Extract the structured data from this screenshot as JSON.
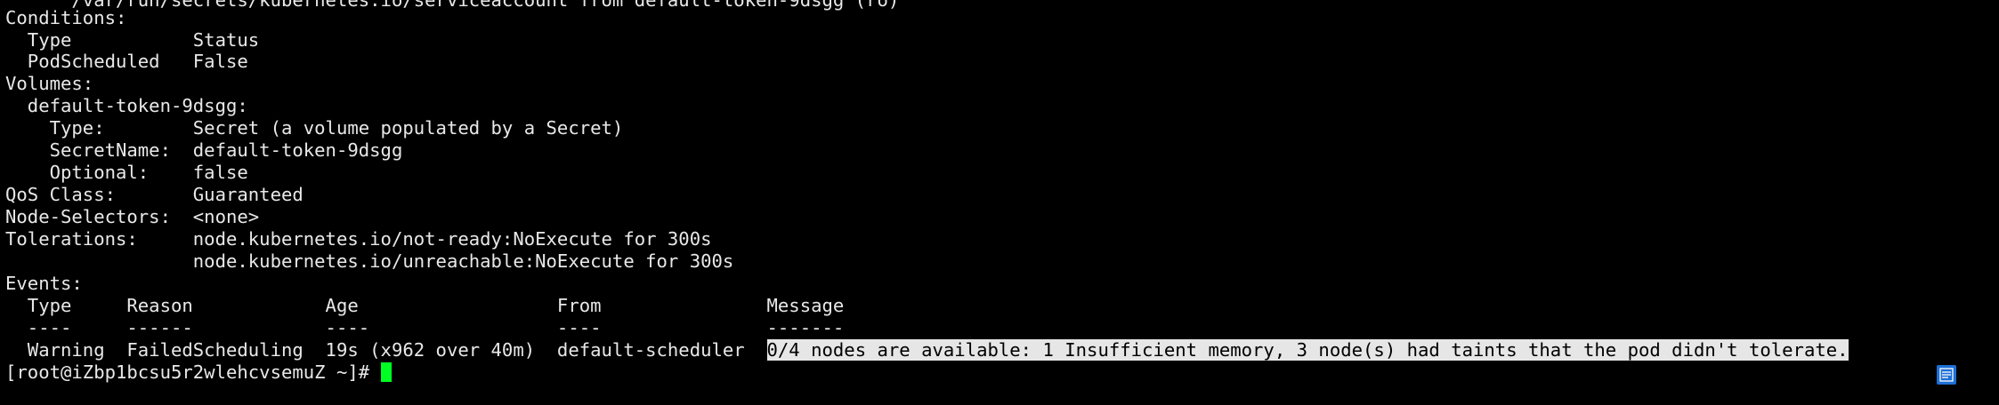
{
  "terminal": {
    "line00": "      /var/run/secrets/kubernetes.io/serviceaccount from default-token-9dsgg (ro)",
    "line01": "Conditions:",
    "line02": "  Type           Status",
    "line03": "  PodScheduled   False",
    "line04": "Volumes:",
    "line05": "  default-token-9dsgg:",
    "line06": "    Type:        Secret (a volume populated by a Secret)",
    "line07": "    SecretName:  default-token-9dsgg",
    "line08": "    Optional:    false",
    "line09": "QoS Class:       Guaranteed",
    "line10": "Node-Selectors:  <none>",
    "line11": "Tolerations:     node.kubernetes.io/not-ready:NoExecute for 300s",
    "line12": "                 node.kubernetes.io/unreachable:NoExecute for 300s",
    "line13": "Events:",
    "line14": "  Type     Reason            Age                  From               Message",
    "line15": "  ----     ------            ----                 ----               -------",
    "line16_prefix": "  Warning  FailedScheduling  19s (x962 over 40m)  default-scheduler  ",
    "line16_message": "0/4 nodes are available: 1 Insufficient memory, 3 node(s) had taints that the pod didn't tolerate.",
    "prompt": "[root@iZbp1bcsu5r2wlehcvsemuZ ~]# "
  },
  "icons": {
    "tray": "notepad-icon"
  },
  "colors": {
    "background": "#000000",
    "foreground": "#e8e8e8",
    "selection": "#e6e6e6",
    "cursor": "#00ff22",
    "tray_icon": "#1d6fd6"
  }
}
